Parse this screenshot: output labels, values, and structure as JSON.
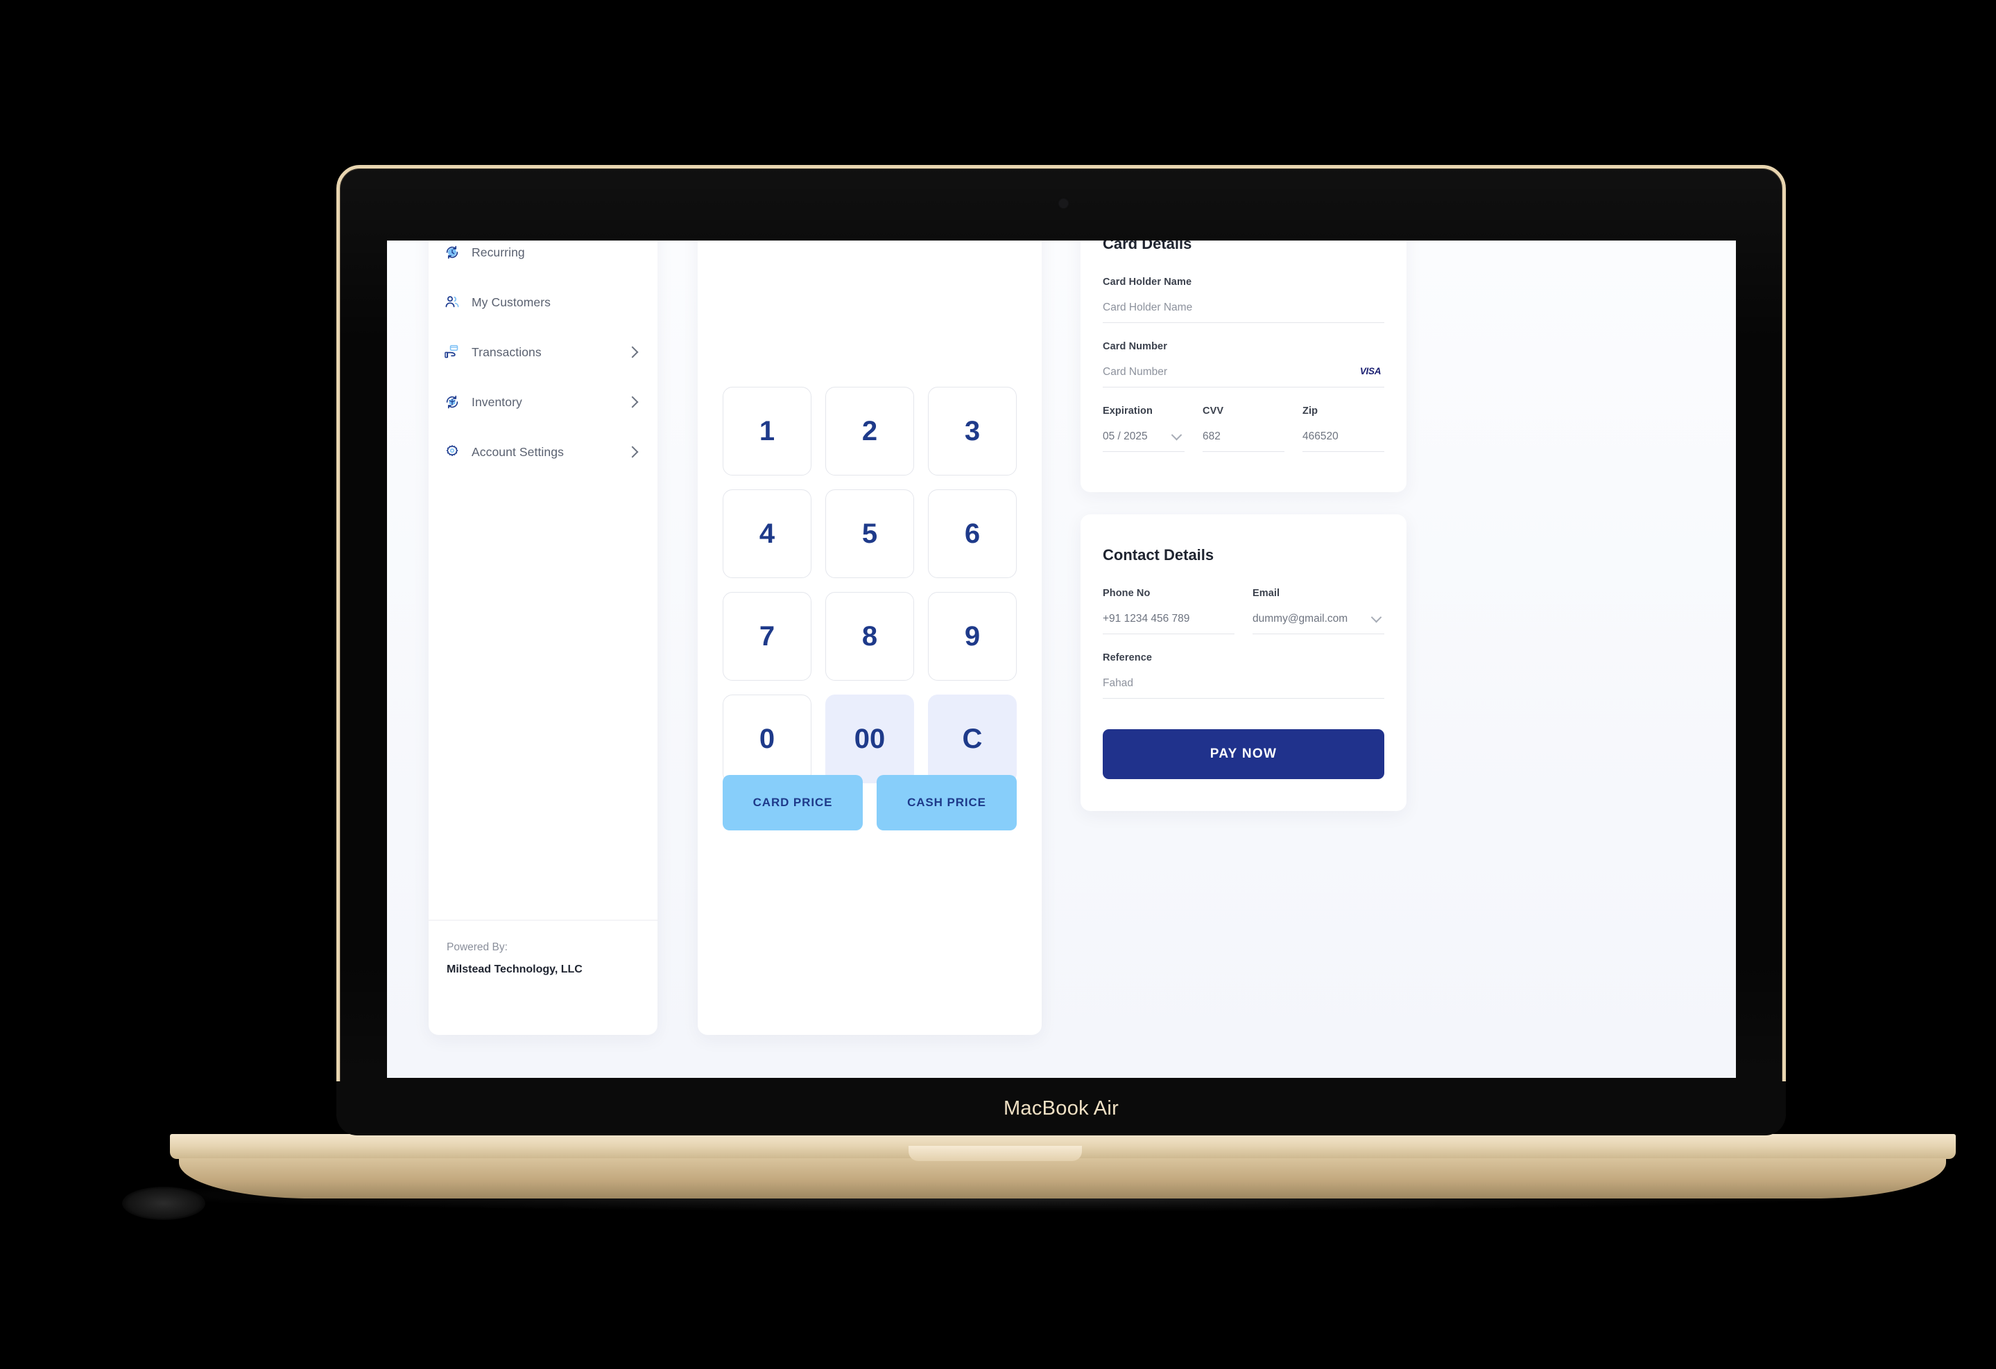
{
  "device": {
    "model_label": "MacBook Air"
  },
  "sidebar": {
    "items": [
      {
        "label": "Recurring",
        "icon": "recurring-clock-icon",
        "has_chevron": false
      },
      {
        "label": "My Customers",
        "icon": "users-icon",
        "has_chevron": false
      },
      {
        "label": "Transactions",
        "icon": "card-in-hand-icon",
        "has_chevron": true
      },
      {
        "label": "Inventory",
        "icon": "inventory-box-icon",
        "has_chevron": true
      },
      {
        "label": "Account Settings",
        "icon": "gear-icon",
        "has_chevron": true
      }
    ],
    "footer": {
      "powered_by_label": "Powered By:",
      "company": "Milstead Technology, LLC"
    }
  },
  "keypad": {
    "keys": [
      {
        "label": "1",
        "accent": false
      },
      {
        "label": "2",
        "accent": false
      },
      {
        "label": "3",
        "accent": false
      },
      {
        "label": "4",
        "accent": false
      },
      {
        "label": "5",
        "accent": false
      },
      {
        "label": "6",
        "accent": false
      },
      {
        "label": "7",
        "accent": false
      },
      {
        "label": "8",
        "accent": false
      },
      {
        "label": "9",
        "accent": false
      },
      {
        "label": "0",
        "accent": false
      },
      {
        "label": "00",
        "accent": true
      },
      {
        "label": "C",
        "accent": true
      }
    ],
    "card_price_label": "CARD PRICE",
    "cash_price_label": "CASH PRICE"
  },
  "card_details": {
    "title": "Card Details",
    "holder_name_label": "Card Holder Name",
    "holder_name_placeholder": "Card Holder Name",
    "card_number_label": "Card Number",
    "card_number_placeholder": "Card Number",
    "card_brand": "VISA",
    "expiration_label": "Expiration",
    "expiration_value": "05 / 2025",
    "cvv_label": "CVV",
    "cvv_value": "682",
    "zip_label": "Zip",
    "zip_value": "466520"
  },
  "contact_details": {
    "title": "Contact Details",
    "phone_label": "Phone No",
    "phone_value": "+91 1234 456 789",
    "email_label": "Email",
    "email_value": "dummy@gmail.com",
    "reference_label": "Reference",
    "reference_value": "Fahad",
    "pay_now_label": "PAY NOW"
  },
  "colors": {
    "primary_blue": "#20328c",
    "digit_blue": "#1e3a8a",
    "key_accent": "#eaeefc",
    "price_button": "#87cefa",
    "visa_blue": "#1a1f71",
    "visa_gold": "#f7b600",
    "bezel_gold": "#e8d5b0"
  }
}
